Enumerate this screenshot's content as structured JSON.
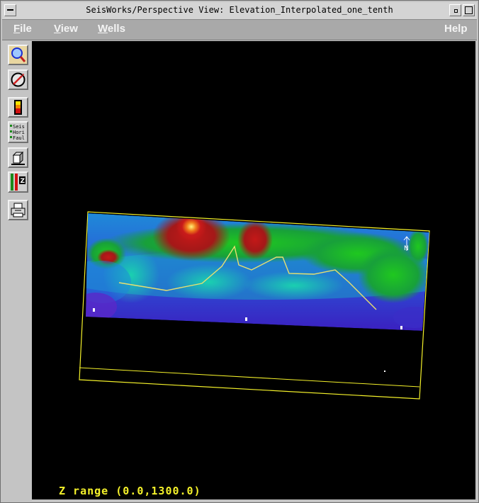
{
  "window": {
    "title": "SeisWorks/Perspective View: Elevation_Interpolated_one_tenth"
  },
  "menu": {
    "file": {
      "underlined": "F",
      "rest": "ile"
    },
    "view": {
      "underlined": "V",
      "rest": "iew"
    },
    "wells": {
      "underlined": "W",
      "rest": "ells"
    },
    "help": "Help"
  },
  "toolbar": {
    "tools": [
      "zoom-icon",
      "rotate-icon",
      "color-scale-icon",
      "layer-toggle-icon",
      "display-box-icon",
      "z-scale-icon",
      "print-icon"
    ],
    "layer_labels": [
      "Seis",
      "Hori",
      "Faul"
    ],
    "z_label": "Z"
  },
  "viewport": {
    "z_range_text": "Z range (0.0,1300.0)",
    "north_label": "N",
    "background": "#000000",
    "outline_color": "#f4f12a"
  }
}
